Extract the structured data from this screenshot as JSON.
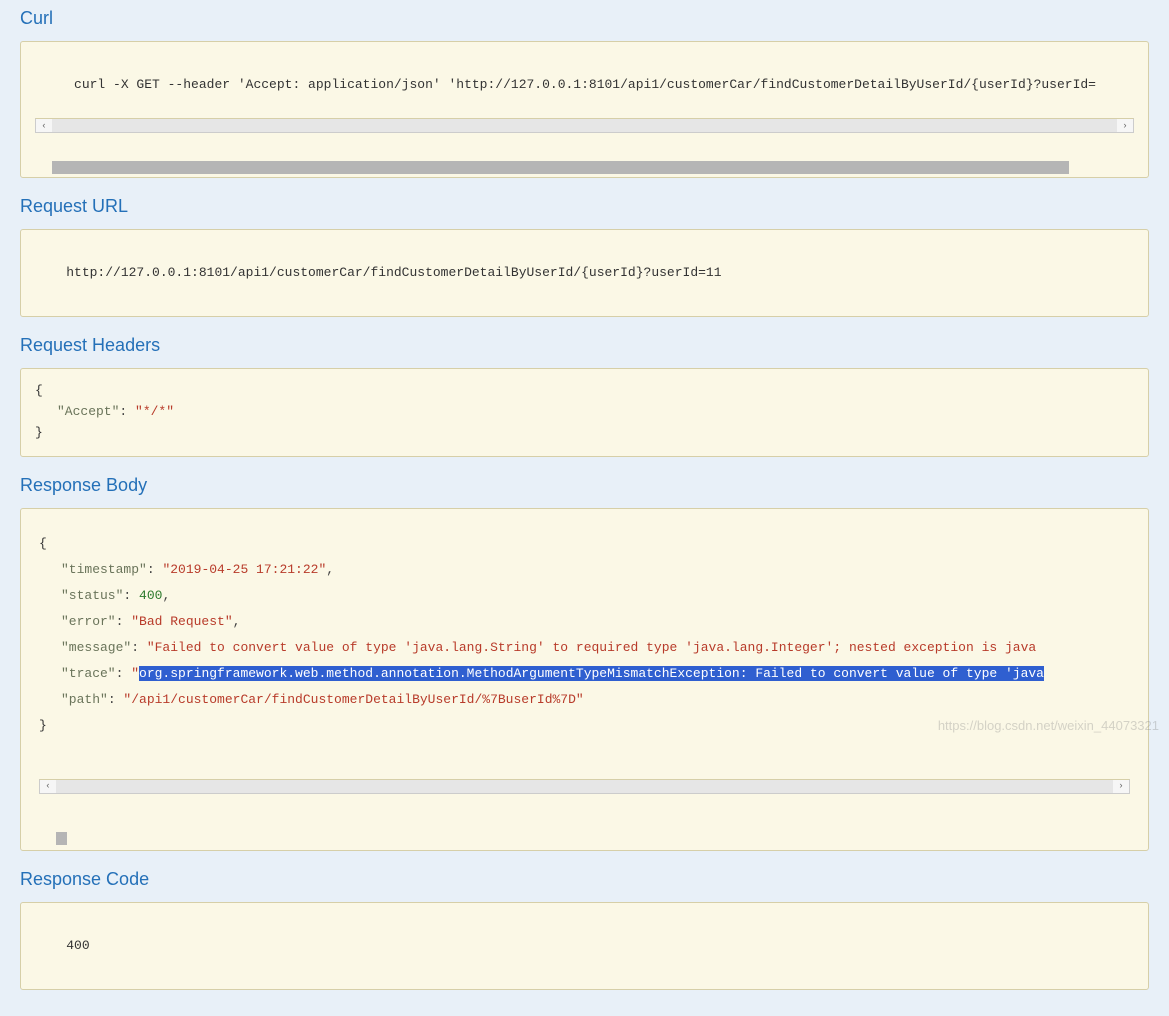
{
  "sections": {
    "curl": {
      "title": "Curl",
      "content": " curl -X GET --header 'Accept: application/json' 'http://127.0.0.1:8101/api1/customerCar/findCustomerDetailByUserId/{userId}?userId="
    },
    "requestUrl": {
      "title": "Request URL",
      "content": "http://127.0.0.1:8101/api1/customerCar/findCustomerDetailByUserId/{userId}?userId=11"
    },
    "requestHeaders": {
      "title": "Request Headers",
      "open": "{",
      "accept_key": "\"Accept\"",
      "accept_val": "\"*/*\"",
      "close": "}"
    },
    "responseBody": {
      "title": "Response Body",
      "open": "{",
      "ts_key": "\"timestamp\"",
      "ts_val": "\"2019-04-25 17:21:22\"",
      "status_key": "\"status\"",
      "status_val": "400",
      "error_key": "\"error\"",
      "error_val": "\"Bad Request\"",
      "message_key": "\"message\"",
      "message_val": "\"Failed to convert value of type 'java.lang.String' to required type 'java.lang.Integer'; nested exception is java",
      "trace_key": "\"trace\"",
      "trace_val_pre": "\"",
      "trace_val_hi": "org.springframework.web.method.annotation.MethodArgumentTypeMismatchException: Failed to convert value of type 'java",
      "path_key": "\"path\"",
      "path_val": "\"/api1/customerCar/findCustomerDetailByUserId/%7BuserId%7D\"",
      "close": "}"
    },
    "responseCode": {
      "title": "Response Code",
      "content": "400"
    }
  },
  "watermark": "https://blog.csdn.net/weixin_44073321"
}
